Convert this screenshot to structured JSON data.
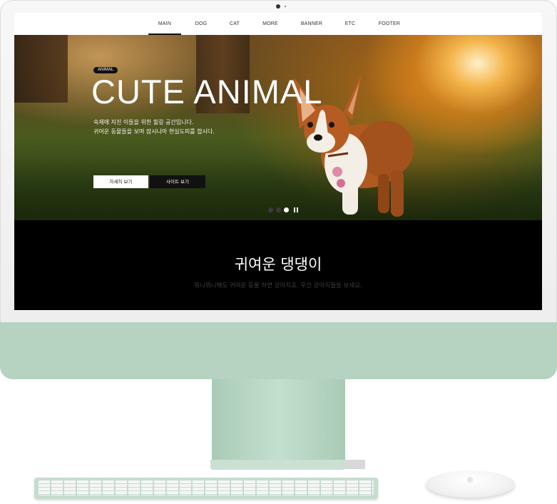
{
  "nav": {
    "items": [
      {
        "label": "MAIN",
        "active": true
      },
      {
        "label": "DOG",
        "active": false
      },
      {
        "label": "CAT",
        "active": false
      },
      {
        "label": "MORE",
        "active": false
      },
      {
        "label": "BANNER",
        "active": false
      },
      {
        "label": "ETC",
        "active": false
      },
      {
        "label": "FOOTER",
        "active": false
      }
    ]
  },
  "hero": {
    "badge": "ANIMAL",
    "headline": "CUTE ANIMAL",
    "description_line1": "숙제에 지친 이들을 위한 힐링 공간입니다.",
    "description_line2": "귀여운 동물들을 보며 잠시나마 현실도피를 합시다.",
    "button_detail": "자세히 보기",
    "button_site": "사이트 보기",
    "slider": {
      "count": 3,
      "active_index": 2,
      "paused": true
    }
  },
  "section": {
    "title": "귀여운 댕댕이",
    "subtitle": "뭐니뭐니해도 귀여운 동물 하면 강아지죠. 우선 강아지들을 보세요."
  },
  "colors": {
    "device_accent": "#b5d3c0",
    "section_background": "#000000",
    "button_dark": "#111111"
  },
  "icons": [
    "camera-icon",
    "pause-icon",
    "apple-logo-icon"
  ]
}
